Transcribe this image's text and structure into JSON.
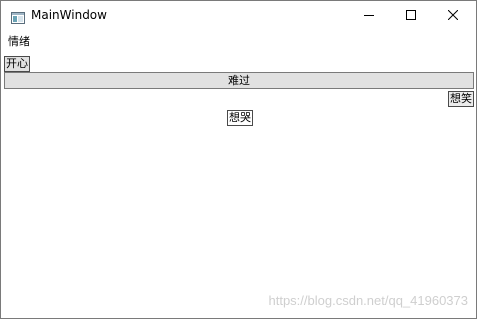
{
  "window": {
    "title": "MainWindow",
    "icon": "window-app-icon"
  },
  "caption_buttons": {
    "minimize_icon": "minimize-icon",
    "maximize_icon": "maximize-icon",
    "close_icon": "close-icon"
  },
  "content": {
    "label": "情绪",
    "buttons": {
      "happy": "开心",
      "sad": "难过",
      "laugh": "想笑",
      "cry": "想哭"
    }
  },
  "watermark": "https://blog.csdn.net/qq_41960373"
}
